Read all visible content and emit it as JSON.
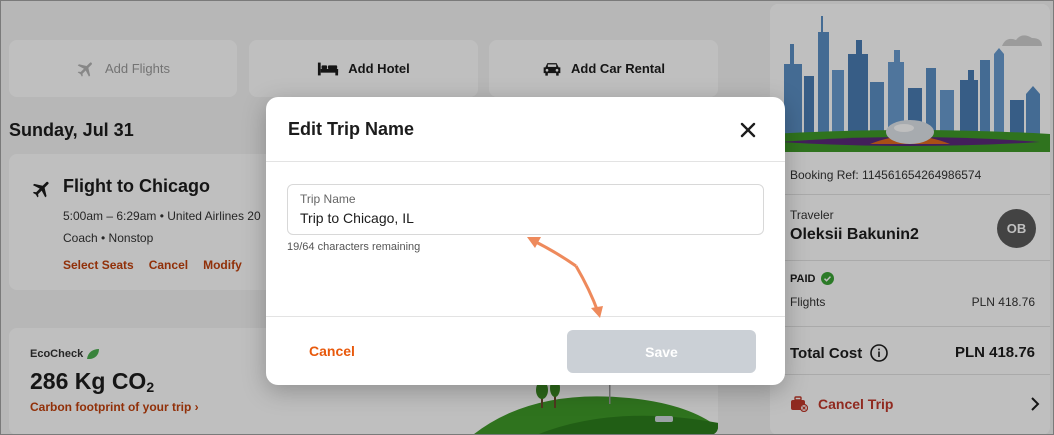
{
  "topbar": {
    "add_flights": "Add Flights",
    "add_hotel": "Add Hotel",
    "add_car_rental": "Add Car Rental"
  },
  "itinerary": {
    "date": "Sunday, Jul 31",
    "flight": {
      "title": "Flight to Chicago",
      "times": "5:00am – 6:29am • United Airlines 20",
      "cabin": "Coach • Nonstop",
      "actions": {
        "select_seats": "Select Seats",
        "cancel": "Cancel",
        "modify": "Modify"
      }
    },
    "eco": {
      "label": "EcoCheck",
      "value": "286 Kg CO",
      "value_sub": "2",
      "link": "Carbon footprint of your trip ›"
    }
  },
  "sidebar": {
    "booking_ref": "Booking Ref: 114561654264986574",
    "traveler_label": "Traveler",
    "traveler_name": "Oleksii Bakunin2",
    "avatar_initials": "OB",
    "paid_label": "PAID",
    "flights_label": "Flights",
    "flights_value": "PLN 418.76",
    "total_label": "Total Cost",
    "total_value": "PLN 418.76",
    "cancel_trip": "Cancel Trip"
  },
  "modal": {
    "title": "Edit Trip Name",
    "field_label": "Trip Name",
    "field_value": "Trip to Chicago, IL",
    "hint": "19/64 characters remaining",
    "cancel_label": "Cancel",
    "save_label": "Save"
  },
  "colors": {
    "accent": "#e8590c",
    "link": "#c2410c",
    "save_disabled": "#cbd0d6",
    "annotation_arrow": "#ee8a5c"
  }
}
